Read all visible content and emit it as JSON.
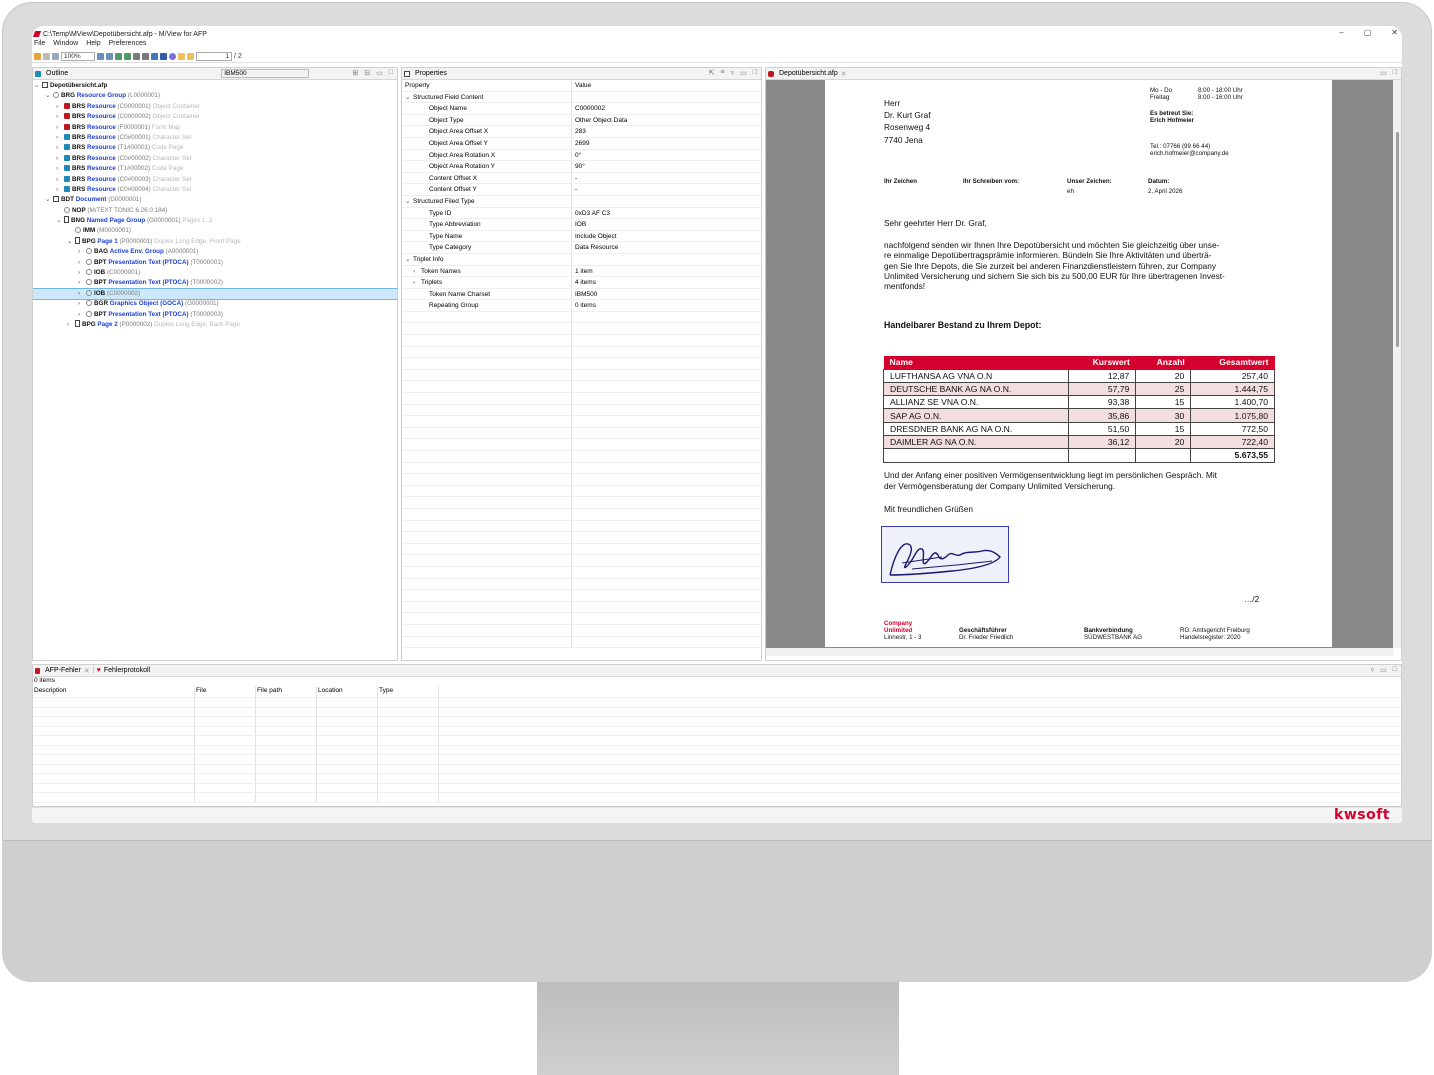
{
  "window": {
    "title": "C:\\Temp\\MView\\Depotübersicht.afp - M/View for AFP",
    "minimize": "–",
    "maximize": "▢",
    "close": "✕"
  },
  "menu": [
    "File",
    "Window",
    "Help",
    "Preferences"
  ],
  "toolbar": {
    "zoom": "100%",
    "page": "1",
    "page_total": "/ 2"
  },
  "outline": {
    "tab_label": "Outline",
    "codepage": "IBM500",
    "rows": [
      {
        "indent": 0,
        "exp": "⌄",
        "icon": "doc",
        "key": "Depotübersicht.afp",
        "label": "",
        "id": "",
        "desc": ""
      },
      {
        "indent": 1,
        "exp": "⌄",
        "icon": "circ",
        "key": "BRG",
        "label": "Resource Group",
        "id": "(L0000001)",
        "desc": ""
      },
      {
        "indent": 2,
        "exp": "›",
        "icon": "res",
        "key": "BRS",
        "label": "Resource",
        "id": "(C0000001)",
        "desc": "Object Container"
      },
      {
        "indent": 2,
        "exp": "›",
        "icon": "res",
        "key": "BRS",
        "label": "Resource",
        "id": "(C0000002)",
        "desc": "Object Container"
      },
      {
        "indent": 2,
        "exp": "›",
        "icon": "res",
        "key": "BRS",
        "label": "Resource",
        "id": "(F0000001)",
        "desc": "Form Map"
      },
      {
        "indent": 2,
        "exp": "›",
        "icon": "cs",
        "key": "BRS",
        "label": "Resource",
        "id": "(C0#00001)",
        "desc": "Character Set"
      },
      {
        "indent": 2,
        "exp": "›",
        "icon": "cs",
        "key": "BRS",
        "label": "Resource",
        "id": "(T1#00001)",
        "desc": "Code Page"
      },
      {
        "indent": 2,
        "exp": "›",
        "icon": "cs",
        "key": "BRS",
        "label": "Resource",
        "id": "(C0#00002)",
        "desc": "Character Set"
      },
      {
        "indent": 2,
        "exp": "›",
        "icon": "cs",
        "key": "BRS",
        "label": "Resource",
        "id": "(T1#00002)",
        "desc": "Code Page"
      },
      {
        "indent": 2,
        "exp": "›",
        "icon": "cs",
        "key": "BRS",
        "label": "Resource",
        "id": "(C0#00003)",
        "desc": "Character Set"
      },
      {
        "indent": 2,
        "exp": "›",
        "icon": "cs",
        "key": "BRS",
        "label": "Resource",
        "id": "(C0#00004)",
        "desc": "Character Set"
      },
      {
        "indent": 1,
        "exp": "⌄",
        "icon": "doc",
        "key": "BDT",
        "label": "Document",
        "id": "(D0000001)",
        "desc": ""
      },
      {
        "indent": 2,
        "exp": "",
        "icon": "circ",
        "key": "NOP",
        "label": "",
        "id": "(M/TEXT TONIC 6.26.0.184)",
        "desc": ""
      },
      {
        "indent": 2,
        "exp": "⌄",
        "icon": "page",
        "key": "BNG",
        "label": "Named Page Group",
        "id": "(G0000001)",
        "desc": "Pages 1..2"
      },
      {
        "indent": 3,
        "exp": "",
        "icon": "circ",
        "key": "IMM",
        "label": "",
        "id": "(M0000001)",
        "desc": ""
      },
      {
        "indent": 3,
        "exp": "⌄",
        "icon": "page",
        "key": "BPG",
        "label": "Page 1",
        "id": "(P0000001)",
        "desc": "Duplex Long Edge, Front Page"
      },
      {
        "indent": 4,
        "exp": "›",
        "icon": "circ",
        "key": "BAG",
        "label": "Active Env. Group",
        "id": "(A0000001)",
        "desc": ""
      },
      {
        "indent": 4,
        "exp": "›",
        "icon": "circ",
        "key": "BPT",
        "label": "Presentation Text (PTOCA)",
        "id": "(T0000001)",
        "desc": ""
      },
      {
        "indent": 4,
        "exp": "›",
        "icon": "circ",
        "key": "IOB",
        "label": "",
        "id": "(C0000001)",
        "desc": ""
      },
      {
        "indent": 4,
        "exp": "›",
        "icon": "circ",
        "key": "BPT",
        "label": "Presentation Text (PTOCA)",
        "id": "(T0000002)",
        "desc": ""
      },
      {
        "indent": 4,
        "exp": "›",
        "icon": "circ",
        "key": "IOB",
        "label": "",
        "id": "(C0000002)",
        "desc": "",
        "selected": true
      },
      {
        "indent": 4,
        "exp": "›",
        "icon": "circ",
        "key": "BGR",
        "label": "Graphics Object (GOCA)",
        "id": "(G0000001)",
        "desc": ""
      },
      {
        "indent": 4,
        "exp": "›",
        "icon": "circ",
        "key": "BPT",
        "label": "Presentation Text (PTOCA)",
        "id": "(T0000003)",
        "desc": ""
      },
      {
        "indent": 3,
        "exp": "›",
        "icon": "page",
        "key": "BPG",
        "label": "Page 2",
        "id": "(P0000002)",
        "desc": "Duplex Long Edge, Back Page"
      }
    ]
  },
  "properties": {
    "tab_label": "Properties",
    "col_property": "Property",
    "col_value": "Value",
    "rows": [
      {
        "indent": 0,
        "exp": "⌄",
        "name": "Structured Field Content",
        "value": ""
      },
      {
        "indent": 2,
        "exp": "",
        "name": "Object Name",
        "value": "C0000002"
      },
      {
        "indent": 2,
        "exp": "",
        "name": "Object Type",
        "value": "Other Object Data"
      },
      {
        "indent": 2,
        "exp": "",
        "name": "Object Area Offset X",
        "value": "283"
      },
      {
        "indent": 2,
        "exp": "",
        "name": "Object Area Offset Y",
        "value": "2699"
      },
      {
        "indent": 2,
        "exp": "",
        "name": "Object Area Rotation X",
        "value": "0°"
      },
      {
        "indent": 2,
        "exp": "",
        "name": "Object Area Rotation Y",
        "value": "90°"
      },
      {
        "indent": 2,
        "exp": "",
        "name": "Content Offset X",
        "value": "-"
      },
      {
        "indent": 2,
        "exp": "",
        "name": "Content Offset Y",
        "value": "-"
      },
      {
        "indent": 0,
        "exp": "⌄",
        "name": "Structured Filed Type",
        "value": ""
      },
      {
        "indent": 2,
        "exp": "",
        "name": "Type ID",
        "value": "0xD3 AF C3"
      },
      {
        "indent": 2,
        "exp": "",
        "name": "Type Abbreviation",
        "value": "IOB"
      },
      {
        "indent": 2,
        "exp": "",
        "name": "Type Name",
        "value": "Include Object"
      },
      {
        "indent": 2,
        "exp": "",
        "name": "Type Category",
        "value": "Data Resource"
      },
      {
        "indent": 0,
        "exp": "⌄",
        "name": "Triplet Info",
        "value": ""
      },
      {
        "indent": 1,
        "exp": "›",
        "name": "Token Names",
        "value": "1 item"
      },
      {
        "indent": 1,
        "exp": "›",
        "name": "Triplets",
        "value": "4 items"
      },
      {
        "indent": 2,
        "exp": "",
        "name": "Token Name Charset",
        "value": "IBM500"
      },
      {
        "indent": 2,
        "exp": "",
        "name": "Repeating Group",
        "value": "0 items"
      }
    ]
  },
  "document": {
    "tab_label": "Depotübersicht.afp",
    "hours1_label": "Mo - Do",
    "hours1": "8:00 - 18:00 Uhr",
    "hours2_label": "Freitag",
    "hours2": "8:00 - 16:00 Uhr",
    "care_label": "Es betreut Sie:",
    "care_name": "Erich Hofmeier",
    "tel": "Tel.: 07766 (99 66 44)",
    "email": "erich.hofmeier@company.de",
    "address": [
      "Herr",
      "Dr. Kurt Graf",
      "Rosenweg 4",
      "7740 Jena"
    ],
    "ref_ihr_zeichen": "Ihr Zeichen",
    "ref_ihr_schreiben": "Ihr Schreiben vom:",
    "ref_unser_zeichen": "Unser Zeichen:",
    "ref_unser_val": "eh",
    "ref_datum": "Datum:",
    "ref_datum_val": "2. April 2026",
    "salutation": "Sehr geehrter Herr Dr. Graf,",
    "body": [
      "nachfolgend senden wir Ihnen Ihre Depotübersicht und möchten Sie gleichzeitig über unse-",
      "re einmalige Depotübertragsprämie informieren. Bündeln Sie Ihre Aktivitäten und überträ-",
      "gen Sie Ihre Depots, die Sie zurzeit bei anderen Finanzdienstleistern führen, zur Company",
      "Unlimited Versicherung und sichern Sie sich bis zu 500,00 EUR für Ihre übertragenen Invest-",
      "mentfonds!"
    ],
    "heading": "Handelbarer Bestand zu Ihrem Depot:",
    "table_headers": [
      "Name",
      "Kurswert",
      "Anzahl",
      "Gesamtwert"
    ],
    "table_rows": [
      [
        "LUFTHANSA AG VNA O.N",
        "12,87",
        "20",
        "257,40"
      ],
      [
        "DEUTSCHE BANK AG NA O.N.",
        "57,79",
        "25",
        "1.444,75"
      ],
      [
        "ALLIANZ SE VNA O.N.",
        "93,38",
        "15",
        "1.400,70"
      ],
      [
        "SAP AG O.N.",
        "35,86",
        "30",
        "1.075,80"
      ],
      [
        "DRESDNER BANK AG NA O.N.",
        "51,50",
        "15",
        "772,50"
      ],
      [
        "DAIMLER AG NA O.N.",
        "36,12",
        "20",
        "722,40"
      ]
    ],
    "table_total": "5.673,55",
    "closing": [
      "Und der Anfang einer positiven Vermögensentwicklung liegt im persönlichen Gespräch. Mit",
      "der Vermögensberatung der Company Unlimited Versicherung."
    ],
    "greeting": "Mit freundlichen Grüßen",
    "page_marker": "…/2",
    "footer": {
      "company": [
        "Company",
        "Unlimited"
      ],
      "company_addr": "Linnestr. 1 - 3",
      "ceo_label": "Geschäftsführer",
      "ceo": "Dr. Frieder Friedlich",
      "bank_label": "Bankverbindung",
      "bank": "SÜDWESTBANK AG",
      "court": "RG: Amtsgericht Freiburg",
      "register": "Handelsregister: 2020"
    }
  },
  "errors": {
    "tab1": "AFP-Fehler",
    "tab2": "Fehlerprotokoll",
    "count": "0 items",
    "columns": [
      "Description",
      "File",
      "File path",
      "Location",
      "Type"
    ]
  },
  "brand": "kwsoft",
  "colors": {
    "accent": "#d4002d",
    "link": "#1a3fd6",
    "selection": "#cde8fa"
  }
}
